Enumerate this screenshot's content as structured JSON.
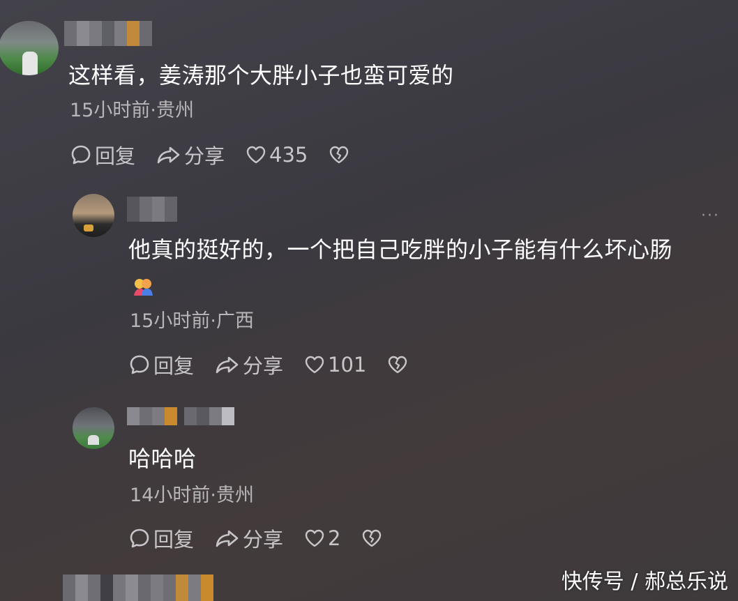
{
  "comments": [
    {
      "text": "这样看，姜涛那个大胖小子也蛮可爱的",
      "meta": "15小时前·贵州",
      "reply_label": "回复",
      "share_label": "分享",
      "like_count": "435"
    },
    {
      "text": "他真的挺好的，一个把自己吃胖的小子能有什么坏心肠",
      "meta": "15小时前·广西",
      "reply_label": "回复",
      "share_label": "分享",
      "like_count": "101"
    },
    {
      "text": "哈哈哈",
      "meta": "14小时前·贵州",
      "reply_label": "回复",
      "share_label": "分享",
      "like_count": "2"
    }
  ],
  "more_label": "···",
  "watermark": "快传号 / 郝总乐说",
  "colors": {
    "text_primary": "#ffffff",
    "text_meta": "#b9b6ba",
    "action": "#c9c6ca",
    "background": "#3d3b41"
  },
  "icons": {
    "reply": "comment-bubble-icon",
    "share": "share-arrow-icon",
    "like": "heart-icon",
    "dislike": "broken-heart-icon",
    "emoji": "hugging-couple-emoji"
  }
}
